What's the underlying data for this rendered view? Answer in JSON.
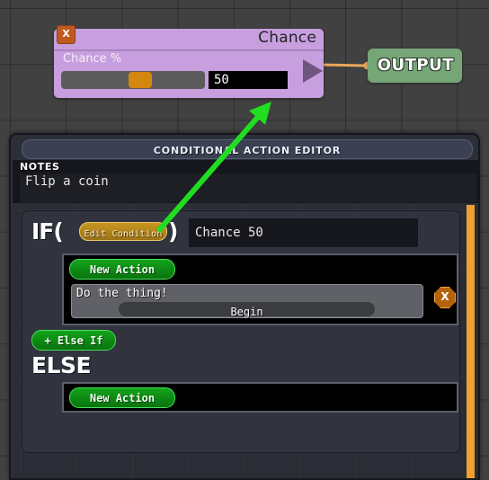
{
  "canvas": {
    "background_color": "#414141",
    "grid_line_color": "#2e2e2e"
  },
  "chance_node": {
    "title": "Chance",
    "close_label": "X",
    "param_label": "Chance %",
    "value": "50",
    "slider_percent": 50,
    "node_color": "#c79fde",
    "handle_color": "#d4870f",
    "close_color": "#c05a21"
  },
  "output_node": {
    "label": "OUTPUT",
    "color": "#76a678",
    "wire_color": "#e8a85c"
  },
  "editor": {
    "title": "CONDITIONAL ACTION EDITOR",
    "notes_label": "NOTES",
    "notes_value": "Flip a coin",
    "if_keyword": "IF(",
    "paren_close": ")",
    "edit_condition_label": "Edit Condition",
    "condition_display": "Chance 50",
    "then_new_action_label": "New Action",
    "action": {
      "title": "Do the thing!",
      "begin_label": "Begin",
      "delete_label": "X"
    },
    "else_if_label": "+ Else If",
    "else_keyword": "ELSE",
    "else_new_action_label": "New Action",
    "scrollbar_color": "#f0a030",
    "accent_green": "#13a31a",
    "accent_gold": "#c89722"
  },
  "annotation": {
    "arrow_color": "#21dd21"
  }
}
